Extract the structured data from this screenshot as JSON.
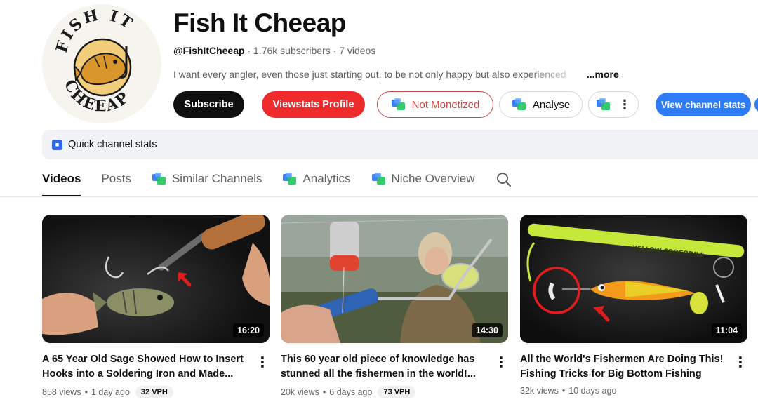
{
  "channel": {
    "logo_text_top": "FISH IT",
    "logo_text_bottom": "CHEEAP",
    "title": "Fish It Cheeap",
    "handle": "@FishItCheeap",
    "subscribers": "1.76k subscribers",
    "videos_count": "7 videos",
    "separator": "·",
    "description": "I want every angler, even those just starting out, to be not only happy but also experienced",
    "more_label": "...more"
  },
  "actions": {
    "subscribe": "Subscribe",
    "viewstats_profile": "Viewstats Profile",
    "not_monetized": "Not Monetized",
    "analyse": "Analyse",
    "view_channel_stats": "View channel stats"
  },
  "quick_stats": {
    "label": "Quick channel stats"
  },
  "tabs": [
    {
      "label": "Videos",
      "active": true
    },
    {
      "label": "Posts"
    },
    {
      "label": "Similar Channels",
      "icon": "viewstats-icon"
    },
    {
      "label": "Analytics",
      "icon": "viewstats-icon"
    },
    {
      "label": "Niche Overview",
      "icon": "viewstats-icon"
    }
  ],
  "videos": [
    {
      "title": "A 65 Year Old Sage Showed How to Insert Hooks into a Soldering Iron and Made...",
      "duration": "16:20",
      "views": "858 views",
      "age": "1 day ago",
      "vph": "32 VPH"
    },
    {
      "title": "This 60 year old piece of knowledge has stunned all the fishermen in the world!...",
      "duration": "14:30",
      "views": "20k views",
      "age": "6 days ago",
      "vph": "73 VPH"
    },
    {
      "title": "All the World's Fishermen Are Doing This! Fishing Tricks for Big Bottom Fishing",
      "duration": "11:04",
      "views": "32k views",
      "age": "10 days ago",
      "rod_text": "YELLOW CROCODILE"
    }
  ],
  "colors": {
    "subscribe_bg": "#0f0f0f",
    "viewstats_red": "#ef2b2b",
    "not_monetized": "#d0453c",
    "accent_blue": "#2d7cf6",
    "quick_bar_bg": "#f1f2f6"
  }
}
